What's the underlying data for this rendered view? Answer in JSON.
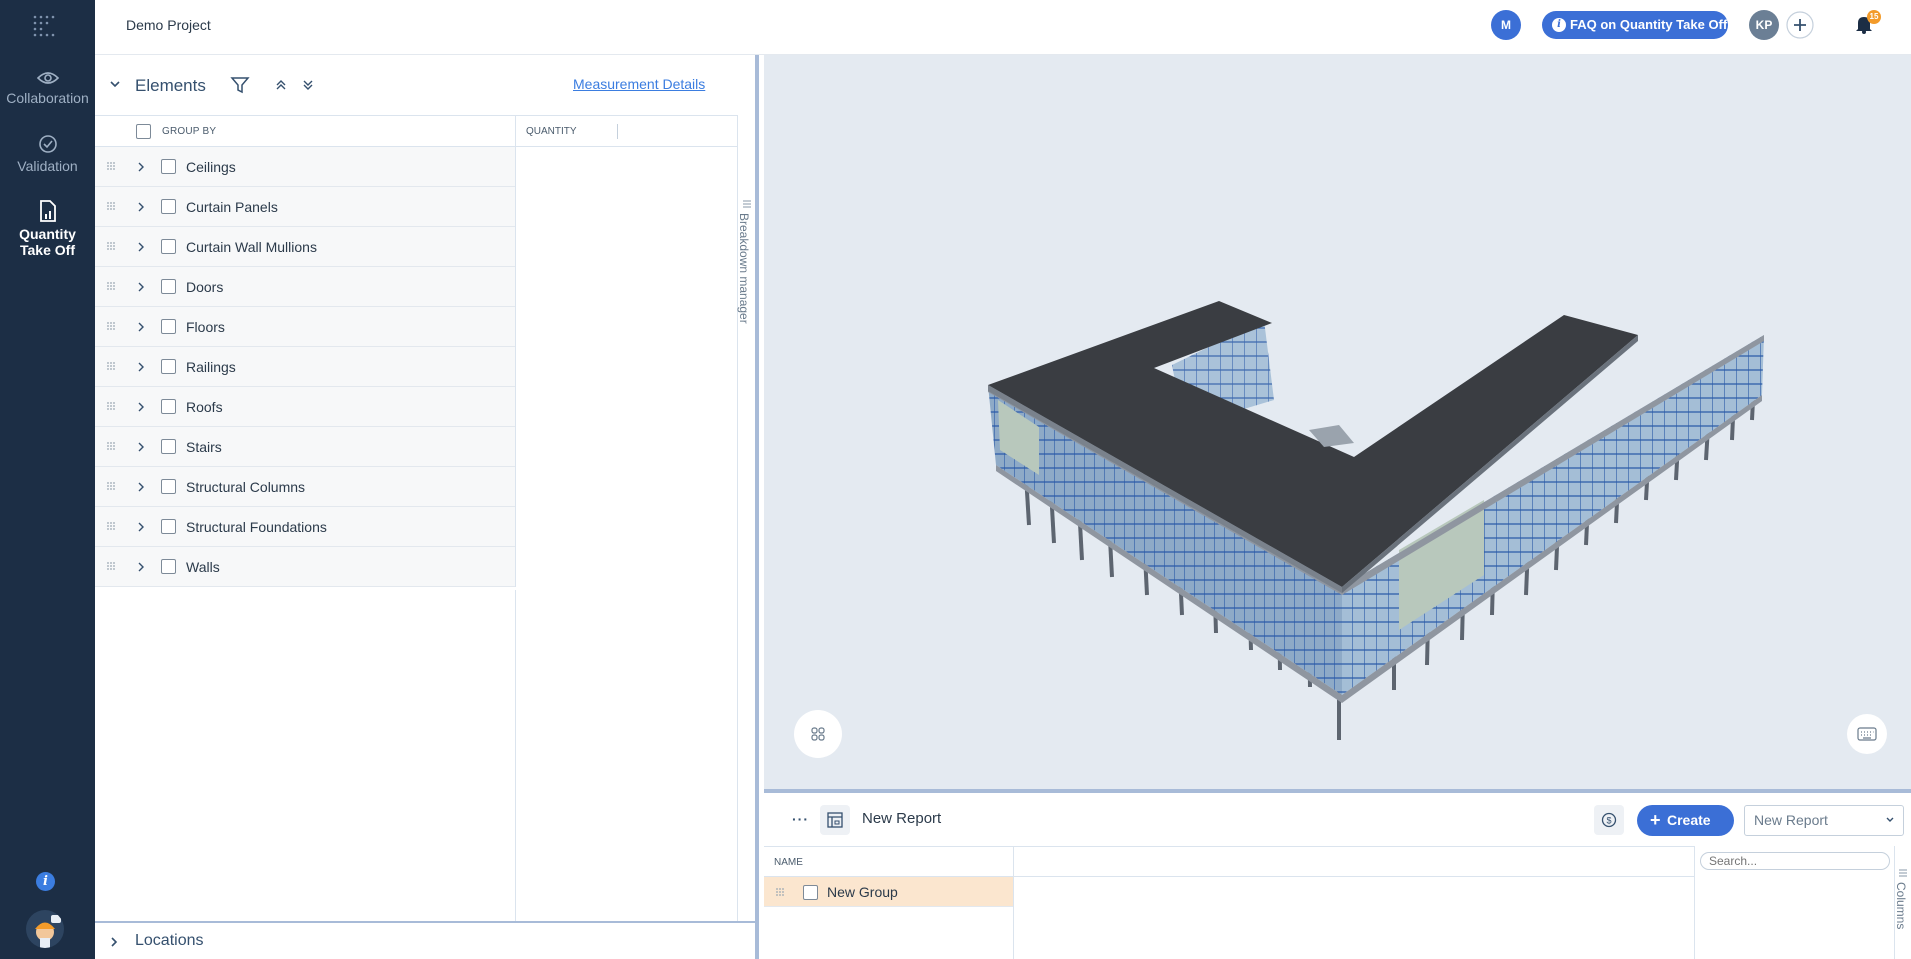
{
  "sidebar": {
    "items": [
      {
        "label": "Collaboration",
        "icon": "eye-icon"
      },
      {
        "label": "Validation",
        "icon": "check-circle-icon"
      },
      {
        "label_line1": "Quantity",
        "label_line2": "Take Off",
        "icon": "quantity-takeoff-icon",
        "active": true
      }
    ],
    "info_icon": "i"
  },
  "topbar": {
    "project_name": "Demo Project",
    "avatar_m": "M",
    "faq_label": "FAQ on Quantity Take Off",
    "avatar_kp": "KP",
    "add_label": "+",
    "notification_count": "15"
  },
  "elements_panel": {
    "title": "Elements",
    "measurement_link": "Measurement Details",
    "columns": {
      "group_by": "GROUP BY",
      "quantity": "QUANTITY"
    },
    "rows": [
      "Ceilings",
      "Curtain Panels",
      "Curtain Wall Mullions",
      "Doors",
      "Floors",
      "Railings",
      "Roofs",
      "Stairs",
      "Structural Columns",
      "Structural Foundations",
      "Walls"
    ],
    "breakdown_label": "Breakdown manager"
  },
  "locations": {
    "title": "Locations"
  },
  "report": {
    "more_label": "···",
    "title": "New Report",
    "create_label": "Create",
    "create_plus": "+",
    "select_value": "New Report",
    "name_header": "NAME",
    "group_row": "New Group",
    "search_placeholder": "Search...",
    "columns_label": "Columns"
  },
  "colors": {
    "sidebar_bg": "#1c2e45",
    "accent": "#3b6fd6",
    "badge": "#f39b2a",
    "selected_row": "#fbe6cf"
  }
}
